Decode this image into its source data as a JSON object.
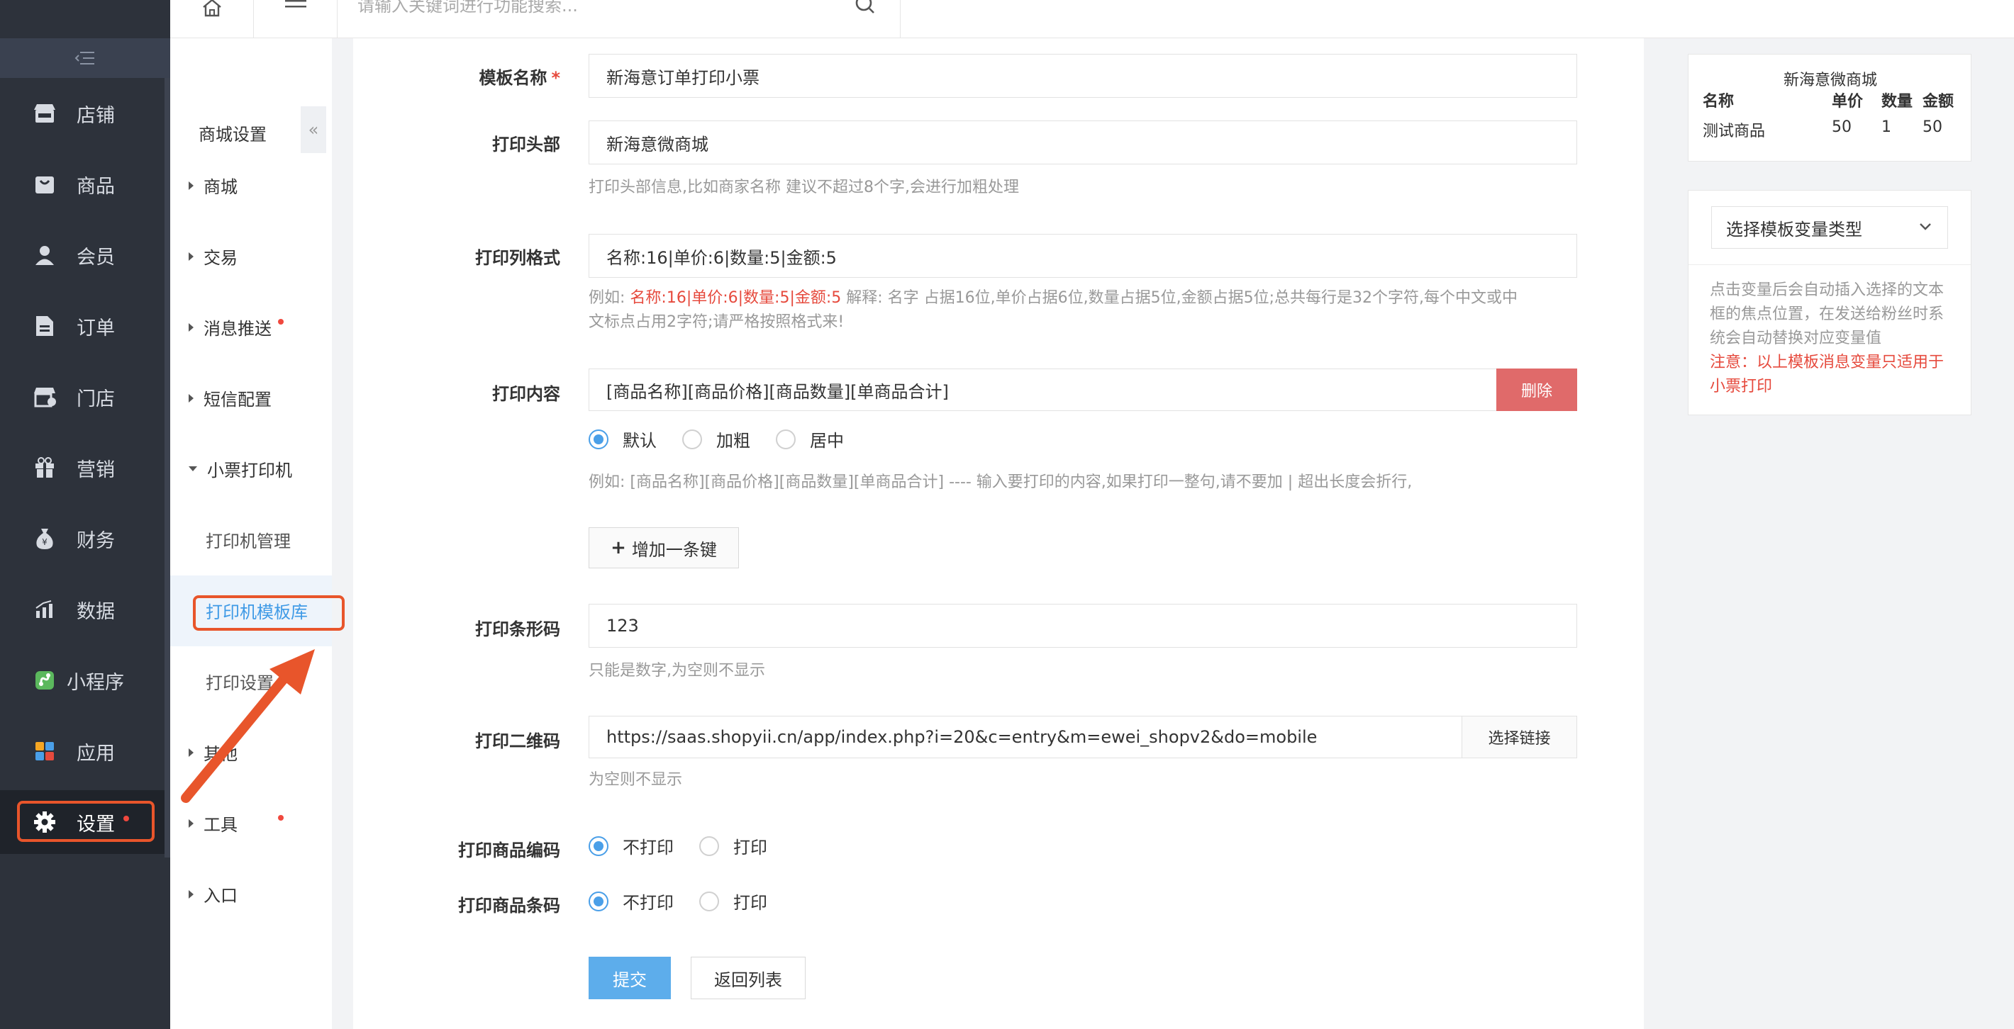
{
  "header": {
    "search_placeholder": "请输入关键词进行功能搜索..."
  },
  "nav": {
    "items": [
      {
        "label": "店铺",
        "icon": "shop-icon"
      },
      {
        "label": "商品",
        "icon": "goods-icon"
      },
      {
        "label": "会员",
        "icon": "member-icon"
      },
      {
        "label": "订单",
        "icon": "order-icon"
      },
      {
        "label": "门店",
        "icon": "store-icon"
      },
      {
        "label": "营销",
        "icon": "gift-icon"
      },
      {
        "label": "财务",
        "icon": "money-bag-icon"
      },
      {
        "label": "数据",
        "icon": "chart-icon"
      },
      {
        "label": "小程序",
        "icon": "miniprogram-icon"
      },
      {
        "label": "应用",
        "icon": "apps-icon"
      },
      {
        "label": "设置",
        "icon": "gear-icon"
      }
    ]
  },
  "subnav": {
    "title": "商城设置",
    "groups": [
      "商城",
      "交易",
      "消息推送",
      "短信配置",
      "小票打印机"
    ],
    "leaves": [
      "打印机管理",
      "打印机模板库",
      "打印设置"
    ],
    "other": "其他",
    "tools": "工具",
    "entry": "入口"
  },
  "form": {
    "template_name": {
      "label": "模板名称",
      "required": "*",
      "value": "新海意订单打印小票"
    },
    "print_header": {
      "label": "打印头部",
      "value": "新海意微商城",
      "help": "打印头部信息,比如商家名称 建议不超过8个字,会进行加粗处理"
    },
    "column_format": {
      "label": "打印列格式",
      "value": "名称:16|单价:6|数量:5|金额:5",
      "help_prefix": "例如: ",
      "help_example": "名称:16|单价:6|数量:5|金额:5",
      "help_line1": " 解释: 名字 占据16位,单价占据6位,数量占据5位,金额占据5位;总共每行是32个字符,每个中文或中",
      "help_line2": "文标点占用2字符;请严格按照格式来!"
    },
    "content": {
      "label": "打印内容",
      "value": "[商品名称][商品价格][商品数量][单商品合计]",
      "delete_label": "删除",
      "radio_default": "默认",
      "radio_bold": "加粗",
      "radio_center": "居中",
      "help": "例如: [商品名称][商品价格][商品数量][单商品合计] ---- 输入要打印的内容,如果打印一整句,请不要加 | 超出长度会折行,",
      "add_label": "增加一条键"
    },
    "barcode": {
      "label": "打印条形码",
      "value": "123",
      "help": "只能是数字,为空则不显示"
    },
    "qrcode": {
      "label": "打印二维码",
      "value": "https://saas.shopyii.cn/app/index.php?i=20&c=entry&m=ewei_shopv2&do=mobile",
      "link_label": "选择链接",
      "help": "为空则不显示"
    },
    "goods_code": {
      "label": "打印商品编码",
      "opt_no": "不打印",
      "opt_yes": "打印"
    },
    "goods_barcode": {
      "label": "打印商品条码",
      "opt_no": "不打印",
      "opt_yes": "打印"
    },
    "submit_label": "提交",
    "back_label": "返回列表"
  },
  "preview": {
    "title": "新海意微商城",
    "headers": [
      "名称",
      "单价",
      "数量",
      "金额"
    ],
    "row": [
      "测试商品",
      "50",
      "1",
      "50"
    ]
  },
  "varpanel": {
    "select_label": "选择模板变量类型",
    "desc": "点击变量后会自动插入选择的文本框的焦点位置，在发送给粉丝时系统会自动替换对应变量值",
    "note": "注意：以上模板消息变量只适用于小票打印"
  },
  "colors": {
    "nav_bg": "#2d323b",
    "accent": "#4a9fe8",
    "danger": "#e06a6a",
    "annotation": "#e8552b"
  }
}
